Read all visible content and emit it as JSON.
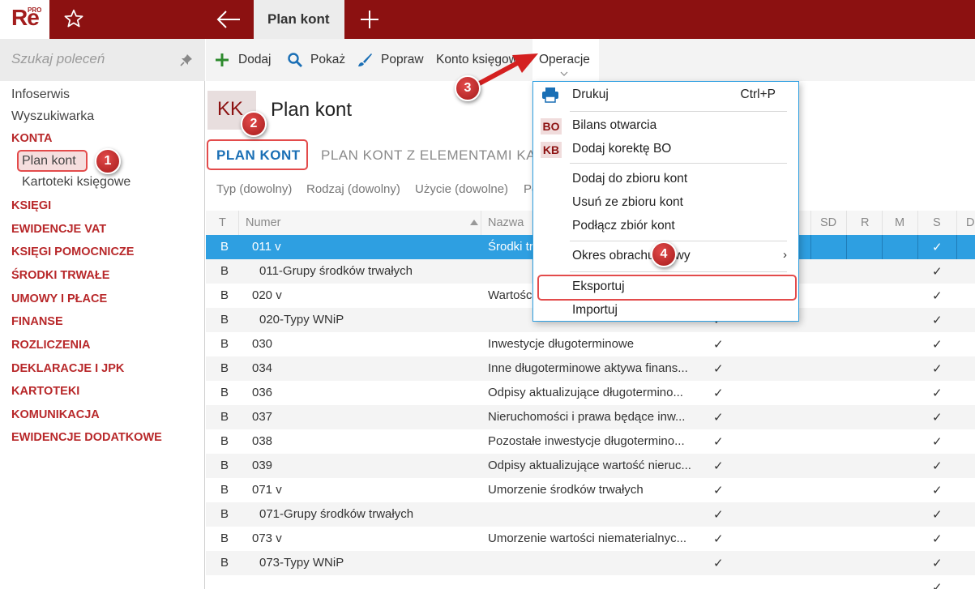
{
  "app": {
    "logo_text": "Re",
    "logo_badge": "PRO"
  },
  "header": {
    "active_tab": "Plan kont"
  },
  "sidebar": {
    "search_placeholder": "Szukaj poleceń",
    "items": [
      {
        "label": "Infoserwis",
        "kind": "normal"
      },
      {
        "label": "Wyszukiwarka",
        "kind": "normal"
      },
      {
        "label": "KONTA",
        "kind": "section"
      },
      {
        "label": "Plan kont",
        "kind": "sub"
      },
      {
        "label": "Kartoteki księgowe",
        "kind": "sub"
      },
      {
        "label": "KSIĘGI",
        "kind": "section"
      },
      {
        "label": "EWIDENCJE VAT",
        "kind": "section"
      },
      {
        "label": "KSIĘGI POMOCNICZE",
        "kind": "section"
      },
      {
        "label": "ŚRODKI TRWAŁE",
        "kind": "section"
      },
      {
        "label": "UMOWY I PŁACE",
        "kind": "section"
      },
      {
        "label": "FINANSE",
        "kind": "section"
      },
      {
        "label": "ROZLICZENIA",
        "kind": "section"
      },
      {
        "label": "DEKLARACJE I JPK",
        "kind": "section"
      },
      {
        "label": "KARTOTEKI",
        "kind": "section"
      },
      {
        "label": "KOMUNIKACJA",
        "kind": "section"
      },
      {
        "label": "EWIDENCJE DODATKOWE",
        "kind": "section"
      }
    ]
  },
  "toolbar": {
    "add": "Dodaj",
    "show": "Pokaż",
    "edit": "Popraw",
    "account": "Konto księgowe",
    "operations": "Operacje"
  },
  "page": {
    "badge": "KK",
    "title": "Plan kont",
    "subtabs": [
      "PLAN KONT",
      "PLAN KONT Z ELEMENTAMI KAR"
    ],
    "filters": [
      "Typ (dowolny)",
      "Rodzaj (dowolny)",
      "Użycie (dowolne)",
      "Po"
    ]
  },
  "grid": {
    "columns": [
      "T",
      "Numer",
      "Nazwa",
      "SD",
      "R",
      "M",
      "S",
      "D"
    ],
    "rows": [
      {
        "t": "B",
        "num": "011 v",
        "name": "Środki tr",
        "mid": "",
        "s": "✓",
        "indent": false
      },
      {
        "t": "B",
        "num": "011-Grupy środków trwałych",
        "name": "",
        "mid": "",
        "s": "✓",
        "indent": true
      },
      {
        "t": "B",
        "num": "020 v",
        "name": "Wartośc",
        "mid": "",
        "s": "✓",
        "indent": false
      },
      {
        "t": "B",
        "num": "020-Typy WNiP",
        "name": "",
        "mid": "✓",
        "s": "✓",
        "indent": true
      },
      {
        "t": "B",
        "num": "030",
        "name": "Inwestycje długoterminowe",
        "mid": "✓",
        "s": "✓",
        "indent": false
      },
      {
        "t": "B",
        "num": "034",
        "name": "Inne długoterminowe aktywa finans...",
        "mid": "✓",
        "s": "✓",
        "indent": false
      },
      {
        "t": "B",
        "num": "036",
        "name": "Odpisy aktualizujące długotermino...",
        "mid": "✓",
        "s": "✓",
        "indent": false
      },
      {
        "t": "B",
        "num": "037",
        "name": "Nieruchomości i prawa będące inw...",
        "mid": "✓",
        "s": "✓",
        "indent": false
      },
      {
        "t": "B",
        "num": "038",
        "name": "Pozostałe inwestycje długotermino...",
        "mid": "✓",
        "s": "✓",
        "indent": false
      },
      {
        "t": "B",
        "num": "039",
        "name": "Odpisy aktualizujące wartość nieruc...",
        "mid": "✓",
        "s": "✓",
        "indent": false
      },
      {
        "t": "B",
        "num": "071 v",
        "name": "Umorzenie środków trwałych",
        "mid": "✓",
        "s": "✓",
        "indent": false
      },
      {
        "t": "B",
        "num": "071-Grupy środków trwałych",
        "name": "",
        "mid": "✓",
        "s": "✓",
        "indent": true
      },
      {
        "t": "B",
        "num": "073 v",
        "name": "Umorzenie wartości niematerialnyc...",
        "mid": "✓",
        "s": "✓",
        "indent": false
      },
      {
        "t": "B",
        "num": "073-Typy WNiP",
        "name": "",
        "mid": "✓",
        "s": "✓",
        "indent": true
      },
      {
        "t": "",
        "num": "",
        "name": "",
        "mid": "",
        "s": "✓",
        "indent": false
      }
    ]
  },
  "menu": {
    "print": "Drukuj",
    "print_shortcut": "Ctrl+P",
    "bo_badge": "BO",
    "bo": "Bilans otwarcia",
    "kb_badge": "KB",
    "kb": "Dodaj korektę BO",
    "add_set": "Dodaj do zbioru kont",
    "remove_set": "Usuń ze zbioru kont",
    "attach_set": "Podłącz zbiór kont",
    "period": "Okres obrachunkowy",
    "export": "Eksportuj",
    "import": "Importuj"
  },
  "markers": [
    "1",
    "2",
    "3",
    "4"
  ],
  "colors": {
    "brand": "#8c1111",
    "accent": "#2e9fe1",
    "section": "#b8282a",
    "marker": "#c62828"
  }
}
